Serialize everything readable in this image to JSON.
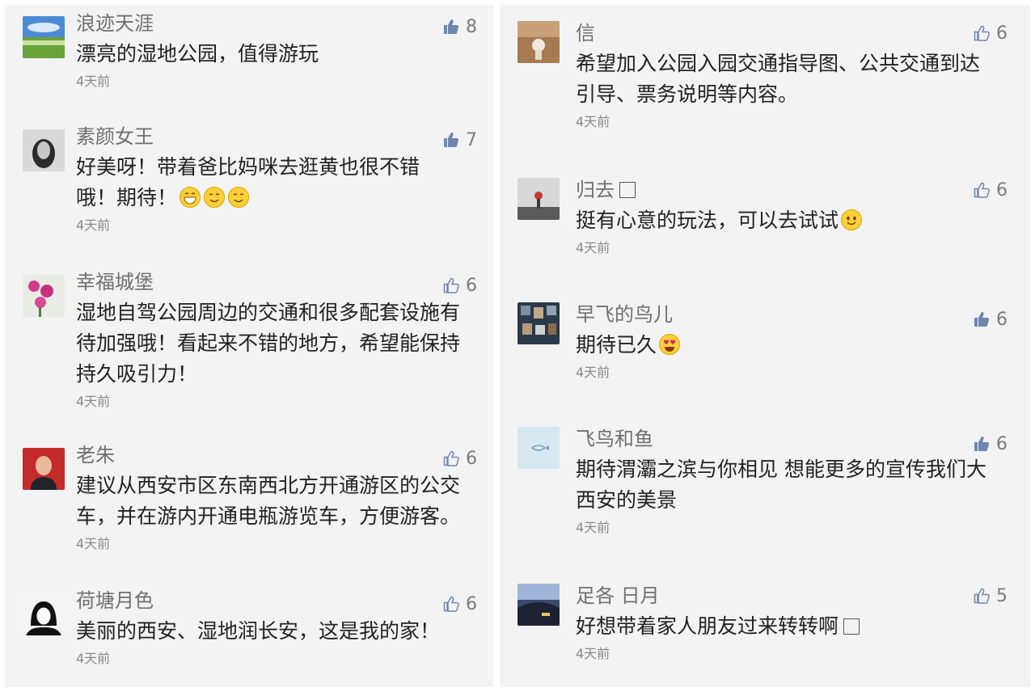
{
  "left": [
    {
      "name": "浪迹天涯",
      "text": "漂亮的湿地公园，值得游玩",
      "time": "4天前",
      "likes": "8"
    },
    {
      "name": "素颜女王",
      "text": "好美呀！带着爸比妈咪去逛黄也很不错哦！期待！",
      "time": "4天前",
      "likes": "7"
    },
    {
      "name": "幸福城堡",
      "text": "湿地自驾公园周边的交通和很多配套设施有待加强哦！看起来不错的地方，希望能保持持久吸引力！",
      "time": "4天前",
      "likes": "6"
    },
    {
      "name": "老朱",
      "text": "建议从西安市区东南西北方开通游区的公交车，并在游内开通电瓶游览车，方便游客。",
      "time": "4天前",
      "likes": "6"
    },
    {
      "name": "荷塘月色",
      "text": "美丽的西安、湿地润长安，这是我的家！",
      "time": "4天前",
      "likes": "6"
    }
  ],
  "right": [
    {
      "name": "信",
      "text": "希望加入公园入园交通指导图、公共交通到达引导、票务说明等内容。",
      "time": "4天前",
      "likes": "6"
    },
    {
      "name": "归去",
      "text": "挺有心意的玩法，可以去试试",
      "time": "4天前",
      "likes": "6"
    },
    {
      "name": "早飞的鸟儿",
      "text": "期待已久",
      "time": "4天前",
      "likes": "6"
    },
    {
      "name": "飞鸟和鱼",
      "text": "期待渭灞之滨与你相见 想能更多的宣传我们大西安的美景",
      "time": "4天前",
      "likes": "6"
    },
    {
      "name": "足各 日月",
      "text": "好想带着家人朋友过来转转啊",
      "time": "4天前",
      "likes": "5"
    }
  ],
  "icons": {
    "like": "thumbs-up-icon",
    "liked_color": "#6f86b0",
    "unliked_color": "#8a9ab8"
  }
}
